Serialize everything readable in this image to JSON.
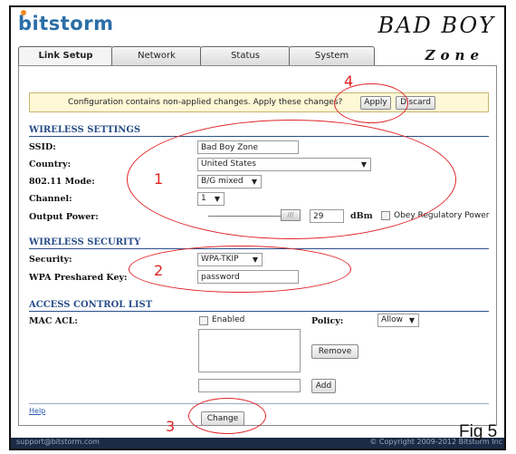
{
  "header": {
    "logo": "bitstorm",
    "brand_line1": "BAD BOY",
    "brand_line2": "Zone"
  },
  "tabs": [
    {
      "label": "Link Setup",
      "active": true
    },
    {
      "label": "Network",
      "active": false
    },
    {
      "label": "Status",
      "active": false
    },
    {
      "label": "System",
      "active": false
    }
  ],
  "notice": {
    "text": "Configuration contains non-applied changes. Apply these changes?",
    "apply_label": "Apply",
    "discard_label": "Discard"
  },
  "wireless_settings": {
    "title": "WIRELESS SETTINGS",
    "ssid_label": "SSID:",
    "ssid_value": "Bad Boy Zone",
    "country_label": "Country:",
    "country_value": "United States",
    "mode_label": "802.11 Mode:",
    "mode_value": "B/G mixed",
    "channel_label": "Channel:",
    "channel_value": "1",
    "power_label": "Output Power:",
    "power_value": "29",
    "power_unit": "dBm",
    "power_level": 1.0,
    "obey_label": "Obey Regulatory Power",
    "obey_checked": false
  },
  "wireless_security": {
    "title": "WIRELESS SECURITY",
    "security_label": "Security:",
    "security_value": "WPA-TKIP",
    "psk_label": "WPA Preshared Key:",
    "psk_value": "password"
  },
  "access_control": {
    "title": "ACCESS CONTROL LIST",
    "mac_acl_label": "MAC ACL:",
    "enabled_label": "Enabled",
    "enabled_checked": false,
    "policy_label": "Policy:",
    "policy_value": "Allow",
    "remove_label": "Remove",
    "add_label": "Add"
  },
  "help_label": "Help",
  "change_label": "Change",
  "footer": {
    "left": "support@bitstorm.com",
    "right": "© Copyright 2009-2012 Bitstorm Inc"
  },
  "annotations": {
    "n1": "1",
    "n2": "2",
    "n3": "3",
    "n4": "4",
    "figure": "Fig 5"
  },
  "colors": {
    "annotation": "#e0262a",
    "section": "#2a4f8a",
    "logo": "#2b6ea8",
    "footer": "#1b2a45",
    "notice_bg": "#fff8d6"
  },
  "icons": {
    "dropdown": "chevron-down-icon"
  }
}
